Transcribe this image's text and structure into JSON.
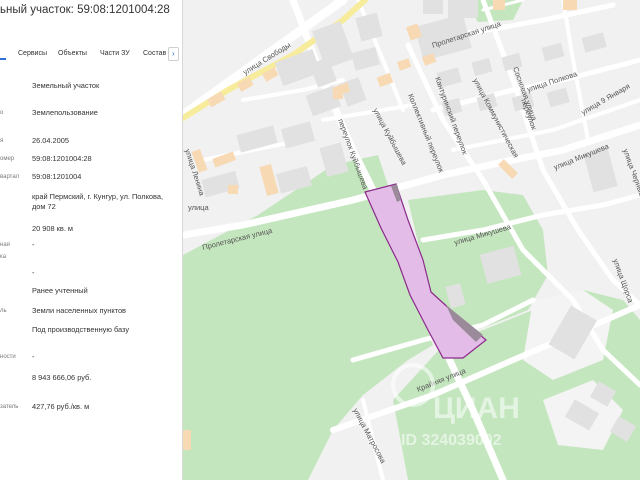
{
  "title": "ьный участок: 59:08:1201004:28",
  "tabs": [
    {
      "label": "Сервисы"
    },
    {
      "label": "Объекты"
    },
    {
      "label": "Части ЗУ"
    },
    {
      "label": "Состав"
    }
  ],
  "tabs_arrow": "›",
  "rows": [
    {
      "label": "",
      "value": "Земельный участок"
    },
    {
      "label": "о",
      "value": "Землепользование"
    },
    {
      "label": "я",
      "value": "26.04.2005"
    },
    {
      "label": "омер",
      "value": "59:08:1201004:28"
    },
    {
      "label": "вартал",
      "value": "59:08:1201004"
    },
    {
      "label": "",
      "value": "край Пермский, г. Кунгур, ул. Полкова, дом 72"
    },
    {
      "label": "",
      "value": "20 908 кв. м"
    },
    {
      "label": "ная",
      "value": "-"
    },
    {
      "label": "ка",
      "value": ""
    },
    {
      "label": "",
      "value": "-"
    },
    {
      "label": "",
      "value": "Ранее учтенный"
    },
    {
      "label": "ль",
      "value": "Земли населенных пунктов"
    },
    {
      "label": "",
      "value": "Под производственную базу"
    },
    {
      "label": "ности",
      "value": "-"
    },
    {
      "label": "",
      "value": "8 943 666,06 руб."
    },
    {
      "label": "затель",
      "value": "427,76 руб./кв. м"
    }
  ],
  "map": {
    "streets": [
      "улица Свободы",
      "Пролетарская улица",
      "улица Полкова",
      "Сосновая улица",
      "улица 9 Января",
      "переулок",
      "Кантуринский переулок",
      "улица Коммунистическая",
      "Пролетарская улица",
      "улица Ленина",
      "переулок Куйбышева",
      "улица Куйбышева",
      "Коллективный переулок",
      "улица Микушева",
      "улица Микушева",
      "Крайняя улица",
      "улица Матросова",
      "улица",
      "улица Чернышевского",
      "улица Щорса"
    ],
    "watermark": "ЦИАН",
    "watermark_id": "ID 324039002",
    "colors": {
      "background": "#f1f1f1",
      "green": "#c4e6be",
      "building": "#e1e1e1",
      "building_orange": "#f7d9b4",
      "road_yellow": "#f7ec9c",
      "parcel_fill": "#e3bde8",
      "parcel_stroke": "#8a2a8a"
    }
  }
}
